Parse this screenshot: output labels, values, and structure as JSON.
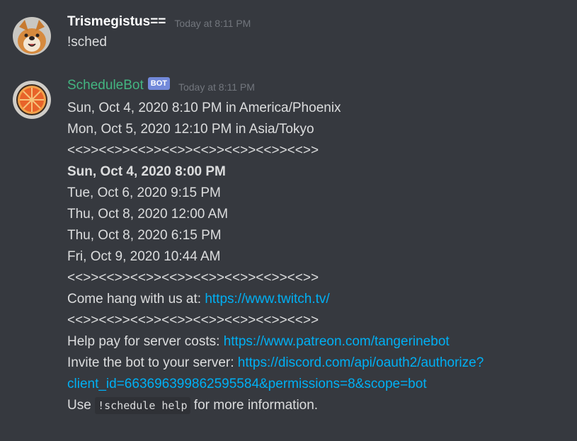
{
  "messages": [
    {
      "username": "Trismegistus==",
      "timestamp": "Today at 8:11 PM",
      "text": "!sched",
      "avatar": "shiba-dog-avatar"
    },
    {
      "username": "ScheduleBot",
      "bot_tag": "BOT",
      "timestamp": "Today at 8:11 PM",
      "avatar": "orange-slice-avatar",
      "lines": {
        "tz1": "Sun, Oct 4, 2020 8:10 PM in America/Phoenix",
        "tz2": "Mon, Oct 5, 2020 12:10 PM in Asia/Tokyo",
        "sep1": "<<>><<>><<>><<>><<>><<>><<>><<>>",
        "s1": "Sun, Oct 4, 2020 8:00 PM",
        "s2": "Tue, Oct 6, 2020 9:15 PM",
        "s3": "Thu, Oct 8, 2020 12:00 AM",
        "s4": "Thu, Oct 8, 2020 6:15 PM",
        "s5": "Fri, Oct 9, 2020 10:44 AM",
        "sep2": "<<>><<>><<>><<>><<>><<>><<>><<>>",
        "hang_prefix": "Come hang with us at: ",
        "hang_link": "https://www.twitch.tv/",
        "sep3": "<<>><<>><<>><<>><<>><<>><<>><<>>",
        "pay_prefix": "Help pay for server costs: ",
        "pay_link": "https://www.patreon.com/tangerinebot",
        "invite_prefix": "Invite the bot to your server: ",
        "invite_link_1": "https://discord.com/api/oauth2/authorize?",
        "invite_link_2": "client_id=663696399862595584&permissions=8&scope=bot",
        "use_prefix": "Use ",
        "use_code": "!schedule help",
        "use_suffix": " for more information."
      }
    }
  ],
  "colors": {
    "background": "#36393f",
    "username": "#ffffff",
    "bot_username": "#43b581",
    "bot_tag": "#7289da",
    "timestamp": "#72767d",
    "text": "#dcddde",
    "link": "#00b0f4",
    "code_bg": "#2f3136"
  }
}
